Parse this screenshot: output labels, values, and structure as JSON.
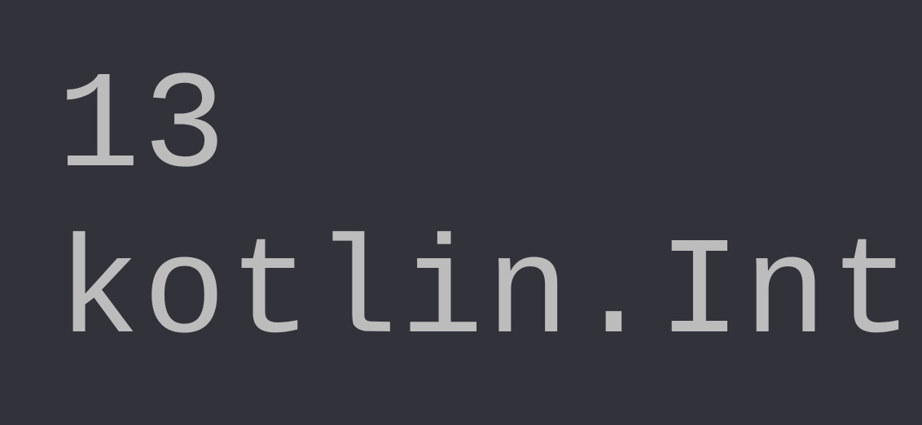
{
  "output": {
    "value": "13",
    "type": "kotlin.Int"
  }
}
